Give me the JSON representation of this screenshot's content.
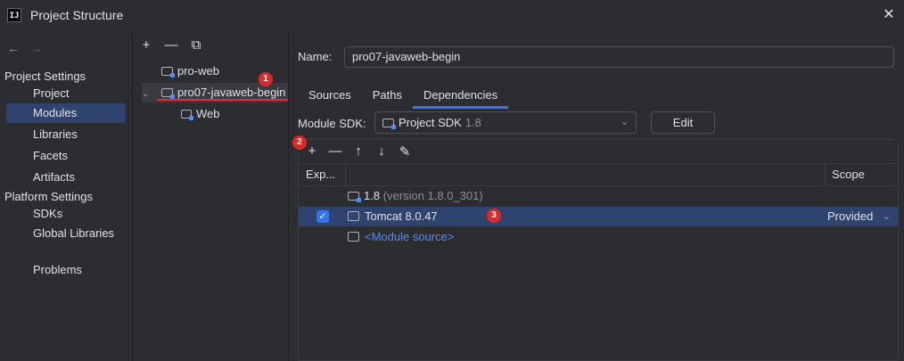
{
  "window": {
    "title": "Project Structure",
    "logo": "IJ"
  },
  "nav": {
    "back": "←",
    "forward": "→"
  },
  "sidebar": {
    "project_settings_header": "Project Settings",
    "project_settings": [
      "Project",
      "Modules",
      "Libraries",
      "Facets",
      "Artifacts"
    ],
    "platform_settings_header": "Platform Settings",
    "platform_settings": [
      "SDKs",
      "Global Libraries"
    ],
    "problems": "Problems"
  },
  "modules_toolbar": {
    "add": "+",
    "remove": "—",
    "copy": "⧉"
  },
  "module_tree": {
    "items": [
      "pro-web",
      "pro07-javaweb-begin",
      "Web"
    ]
  },
  "annotations": {
    "badge1": "1",
    "badge2": "2",
    "badge3": "3"
  },
  "details": {
    "name_label": "Name:",
    "name_value": "pro07-javaweb-begin",
    "tabs": [
      "Sources",
      "Paths",
      "Dependencies"
    ],
    "module_sdk_label": "Module SDK:",
    "module_sdk_value": "Project SDK",
    "module_sdk_version": "1.8",
    "edit_button": "Edit"
  },
  "dependencies": {
    "toolbar": {
      "add": "+",
      "remove": "—",
      "up": "↑",
      "down": "↓",
      "edit": "✎"
    },
    "columns": {
      "export": "Exp...",
      "scope": "Scope"
    },
    "rows": [
      {
        "name": "1.8",
        "detail": "(version 1.8.0_301)"
      },
      {
        "name": "Tomcat 8.0.47",
        "scope": "Provided",
        "checked": true
      },
      {
        "name": "<Module source>"
      }
    ]
  },
  "colors": {
    "selection": "#2e436e",
    "accent": "#3574f0",
    "badge": "#e02828"
  }
}
